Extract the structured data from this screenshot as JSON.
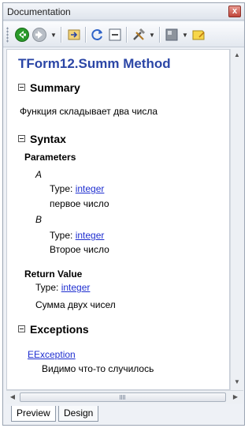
{
  "window": {
    "title": "Documentation",
    "close_glyph": "x"
  },
  "toolbar": {
    "icons": [
      "back-icon",
      "forward-icon",
      "dropdown-icon",
      "navigate-icon",
      "refresh-icon",
      "collapse-icon",
      "tools-icon",
      "dropdown-icon",
      "view-icon",
      "dropdown-icon",
      "note-icon"
    ]
  },
  "doc": {
    "title": "TForm12.Summ Method",
    "summary": {
      "heading": "Summary",
      "text": "Функция складывает два числа"
    },
    "syntax": {
      "heading": "Syntax",
      "parameters_label": "Parameters",
      "params": [
        {
          "name": "A",
          "type_label": "Type:",
          "type": "integer",
          "desc": "первое число"
        },
        {
          "name": "B",
          "type_label": "Type:",
          "type": "integer",
          "desc": "Второе число"
        }
      ],
      "return_label": "Return Value",
      "return_type_label": "Type:",
      "return_type": "integer",
      "return_desc": "Сумма двух чисел"
    },
    "exceptions": {
      "heading": "Exceptions",
      "items": [
        {
          "name": "EException",
          "desc": "Видимо что-то случилось"
        }
      ]
    }
  },
  "tabs": [
    {
      "label": "Preview",
      "active": true
    },
    {
      "label": "Design",
      "active": false
    }
  ],
  "colors": {
    "title": "#2b46a6",
    "link": "#1f2fd0",
    "back_button": "#2a9a2a"
  }
}
